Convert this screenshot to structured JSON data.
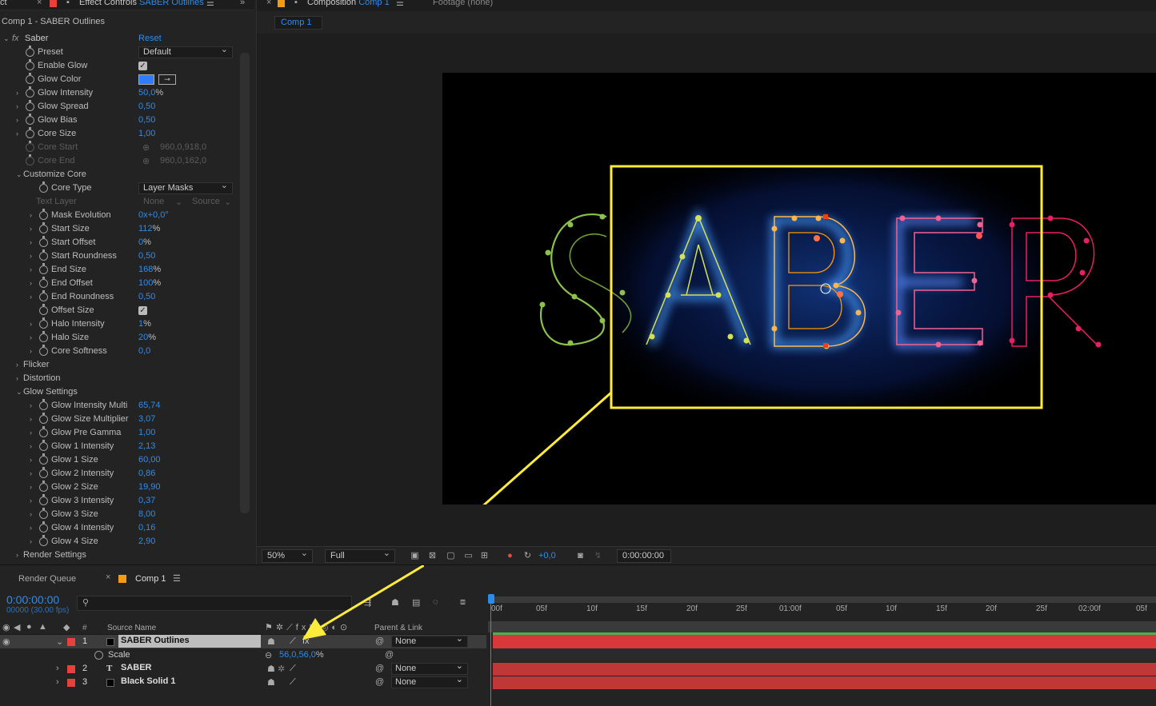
{
  "effect_controls": {
    "tab_left_fragment": "ct",
    "tab_title": "Effect Controls",
    "tab_layer": "SABER Outlines",
    "subtitle": "Comp 1 - SABER Outlines",
    "effect_name": "Saber",
    "reset_label": "Reset",
    "props": {
      "preset": {
        "label": "Preset",
        "value": "Default"
      },
      "enable_glow": {
        "label": "Enable Glow",
        "checked": "✓"
      },
      "glow_color": {
        "label": "Glow Color",
        "color": "#2f7dff"
      },
      "glow_intensity": {
        "label": "Glow Intensity",
        "value": "50,0",
        "unit": "%"
      },
      "glow_spread": {
        "label": "Glow Spread",
        "value": "0,50"
      },
      "glow_bias": {
        "label": "Glow Bias",
        "value": "0,50"
      },
      "core_size": {
        "label": "Core Size",
        "value": "1,00"
      },
      "core_start": {
        "label": "Core Start",
        "value": "960,0,918,0"
      },
      "core_end": {
        "label": "Core End",
        "value": "960,0,162,0"
      },
      "customize_core": {
        "label": "Customize Core"
      },
      "core_type": {
        "label": "Core Type",
        "value": "Layer Masks"
      },
      "text_layer": {
        "label": "Text Layer",
        "value": "None",
        "source": "Source"
      },
      "mask_evolution": {
        "label": "Mask Evolution",
        "value": "0x+0,0°"
      },
      "start_size": {
        "label": "Start Size",
        "value": "112",
        "unit": "%"
      },
      "start_offset": {
        "label": "Start Offset",
        "value": "0",
        "unit": "%"
      },
      "start_roundness": {
        "label": "Start Roundness",
        "value": "0,50"
      },
      "end_size": {
        "label": "End Size",
        "value": "168",
        "unit": "%"
      },
      "end_offset": {
        "label": "End Offset",
        "value": "100",
        "unit": "%"
      },
      "end_roundness": {
        "label": "End Roundness",
        "value": "0,50"
      },
      "offset_size": {
        "label": "Offset Size",
        "checked": "✓"
      },
      "halo_intensity": {
        "label": "Halo Intensity",
        "value": "1",
        "unit": "%"
      },
      "halo_size": {
        "label": "Halo Size",
        "value": "20",
        "unit": "%"
      },
      "core_softness": {
        "label": "Core Softness",
        "value": "0,0"
      },
      "flicker": {
        "label": "Flicker"
      },
      "distortion": {
        "label": "Distortion"
      },
      "glow_settings": {
        "label": "Glow Settings"
      },
      "glow_intensity_multi": {
        "label": "Glow Intensity Multi",
        "value": "65,74"
      },
      "glow_size_multiplier": {
        "label": "Glow Size Multiplier",
        "value": "3,07"
      },
      "glow_pre_gamma": {
        "label": "Glow Pre Gamma",
        "value": "1,00"
      },
      "glow1_intensity": {
        "label": "Glow 1 Intensity",
        "value": "2,13"
      },
      "glow1_size": {
        "label": "Glow 1 Size",
        "value": "60,00"
      },
      "glow2_intensity": {
        "label": "Glow 2 Intensity",
        "value": "0,86"
      },
      "glow2_size": {
        "label": "Glow 2 Size",
        "value": "19,90"
      },
      "glow3_intensity": {
        "label": "Glow 3 Intensity",
        "value": "0,37"
      },
      "glow3_size": {
        "label": "Glow 3 Size",
        "value": "8,00"
      },
      "glow4_intensity": {
        "label": "Glow 4 Intensity",
        "value": "0,16"
      },
      "glow4_size": {
        "label": "Glow 4 Size",
        "value": "2,90"
      },
      "render_settings": {
        "label": "Render Settings"
      }
    }
  },
  "composition": {
    "tab_title": "Composition",
    "tab_comp": "Comp 1",
    "footage_tab": "Footage (none)",
    "sub_tab": "Comp 1",
    "canvas_text": "SABER",
    "magnification": "50%",
    "resolution": "Full",
    "exposure": "+0,0",
    "timecode": "0:00:00:00"
  },
  "timeline": {
    "render_queue": "Render Queue",
    "comp_tab": "Comp 1",
    "timecode": "0:00:00:00",
    "frame_info": "00000 (30.00 fps)",
    "col_number": "#",
    "col_source": "Source Name",
    "col_parent": "Parent & Link",
    "ruler": [
      "00f",
      "05f",
      "10f",
      "15f",
      "20f",
      "25f",
      "01:00f",
      "05f",
      "10f",
      "15f",
      "20f",
      "25f",
      "02:00f",
      "05f"
    ],
    "layers": [
      {
        "num": "1",
        "name": "SABER Outlines",
        "parent": "None",
        "label_color": "#e8413c"
      },
      {
        "num": "2",
        "name": "SABER",
        "parent": "None",
        "label_color": "#e8413c"
      },
      {
        "num": "3",
        "name": "Black Solid 1",
        "parent": "None",
        "label_color": "#e8413c"
      }
    ],
    "scale": {
      "label": "Scale",
      "value": "56,0,56,0",
      "unit": "%"
    }
  }
}
